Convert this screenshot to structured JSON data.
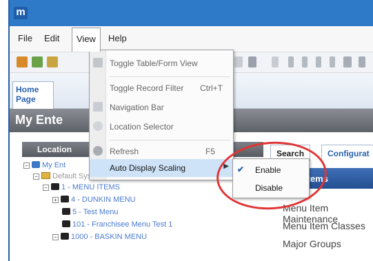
{
  "app": {
    "logo_letter": "m"
  },
  "menubar": {
    "items": [
      {
        "label": "File"
      },
      {
        "label": "Edit"
      },
      {
        "label": "View"
      },
      {
        "label": "Help"
      }
    ]
  },
  "home_tab": {
    "label": "Home Page"
  },
  "page": {
    "title": "My Ente"
  },
  "left_panel": {
    "header": "Location",
    "tree": [
      {
        "label": "My Ent",
        "type": "root"
      },
      {
        "label": "Default System Menu",
        "type": "folder"
      },
      {
        "label": "1 - MENU ITEMS",
        "type": "node"
      },
      {
        "label": "4 - DUNKIN MENU",
        "type": "node"
      },
      {
        "label": "5 - Test Menu",
        "type": "node"
      },
      {
        "label": "101 - Franchisee Menu Test 1",
        "type": "node"
      },
      {
        "label": "1000 - BASKIN MENU",
        "type": "node"
      }
    ]
  },
  "right_panel": {
    "tabs": [
      {
        "label": "Search"
      },
      {
        "label": "Configurat"
      }
    ],
    "section_header": "Items",
    "links": [
      {
        "label": "Menu Item Maintenance"
      },
      {
        "label": "Menu Item Classes"
      },
      {
        "label": "Major Groups"
      }
    ]
  },
  "view_menu": {
    "items": [
      {
        "label": "Toggle Table/Form View",
        "shortcut": ""
      },
      {
        "label": "Toggle Record Filter",
        "shortcut": "Ctrl+T"
      },
      {
        "label": "Navigation Bar",
        "shortcut": ""
      },
      {
        "label": "Location Selector",
        "shortcut": ""
      },
      {
        "label": "Refresh",
        "shortcut": "F5"
      },
      {
        "label": "Auto Display Scaling",
        "shortcut": ""
      }
    ]
  },
  "scaling_submenu": {
    "items": [
      {
        "label": "Enable",
        "checked": true
      },
      {
        "label": "Disable",
        "checked": false
      }
    ]
  },
  "colors": {
    "titlebar": "#2f79c9",
    "highlight": "#cfe3f8",
    "annotation": "#e03535",
    "section_header": "#2f5fa6"
  }
}
